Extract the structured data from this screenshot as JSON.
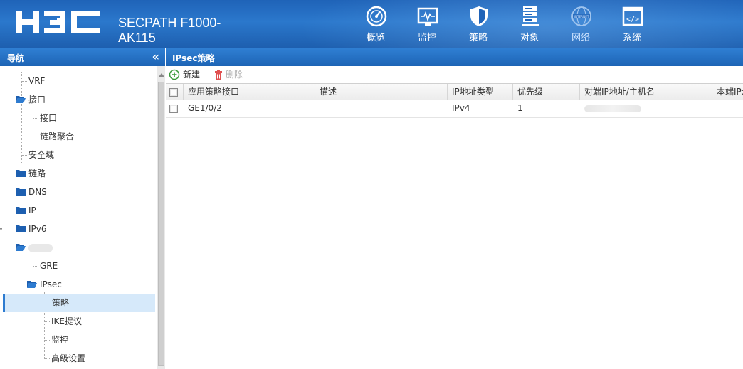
{
  "header": {
    "logo_text": "H3C",
    "product_name": "SECPATH F1000-AK115",
    "nav": [
      {
        "label": "概览",
        "icon": "dashboard-icon"
      },
      {
        "label": "监控",
        "icon": "monitor-icon"
      },
      {
        "label": "策略",
        "icon": "shield-icon"
      },
      {
        "label": "对象",
        "icon": "server-stack-icon"
      },
      {
        "label": "网络",
        "icon": "internet-globe-icon",
        "active": true
      },
      {
        "label": "系统",
        "icon": "code-window-icon"
      }
    ]
  },
  "sidebar": {
    "title": "导航",
    "collapse_glyph": "«",
    "items": [
      {
        "label": "VRF",
        "type": "leaf"
      },
      {
        "label": "接口",
        "type": "folder"
      },
      {
        "label": "接口",
        "type": "leaf"
      },
      {
        "label": "链路聚合",
        "type": "leaf"
      },
      {
        "label": "安全域",
        "type": "leaf"
      },
      {
        "label": "链路",
        "type": "folder"
      },
      {
        "label": "DNS",
        "type": "folder"
      },
      {
        "label": "IP",
        "type": "folder"
      },
      {
        "label": "IPv6",
        "type": "folder"
      },
      {
        "label": "",
        "type": "folder",
        "redacted": true
      },
      {
        "label": "GRE",
        "type": "leaf"
      },
      {
        "label": "IPsec",
        "type": "folder"
      },
      {
        "label": "策略",
        "type": "leaf",
        "selected": true
      },
      {
        "label": "IKE提议",
        "type": "leaf"
      },
      {
        "label": "监控",
        "type": "leaf"
      },
      {
        "label": "高级设置",
        "type": "leaf"
      }
    ]
  },
  "main": {
    "title": "IPsec策略",
    "toolbar": {
      "add_label": "新建",
      "delete_label": "删除"
    },
    "columns": [
      "应用策略接口",
      "描述",
      "IP地址类型",
      "优先级",
      "对端IP地址/主机名",
      "本端IP:"
    ],
    "rows": [
      {
        "interface": "GE1/0/2",
        "description": "",
        "ip_type": "IPv4",
        "priority": "1",
        "peer": "",
        "local": ""
      }
    ]
  },
  "colors": {
    "header_blue": "#1f63b8",
    "title_bar_blue": "#2f7fd3",
    "selected_bg": "#d6e9fa",
    "add_green": "#3a9a3a",
    "delete_red": "#e05050"
  }
}
